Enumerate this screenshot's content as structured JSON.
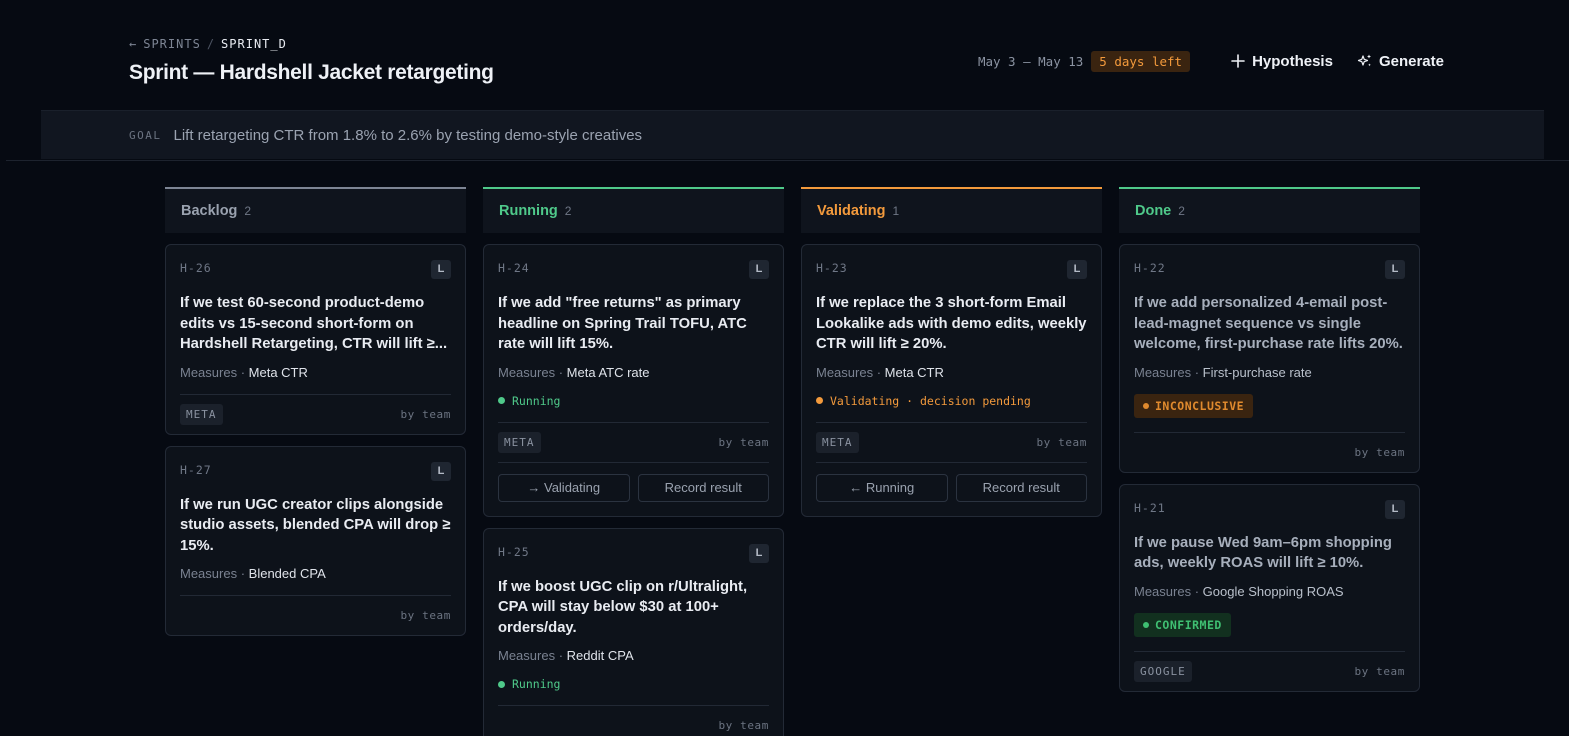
{
  "breadcrumb": {
    "back_arrow": "←",
    "parent": "SPRINTS",
    "separator": "/",
    "current": "SPRINT_D"
  },
  "page_title": "Sprint — Hardshell Jacket retargeting",
  "header": {
    "dates": "May 3 – May 13",
    "days_left": "5 days left",
    "hypothesis_button": "Hypothesis",
    "generate_button": "Generate"
  },
  "goal": {
    "label": "GOAL",
    "text": "Lift retargeting CTR from 1.8% to 2.6% by testing demo-style creatives"
  },
  "colors": {
    "backlog": "#8a92a0",
    "running": "#4fc98a",
    "validating": "#f39a3c",
    "done": "#4fc98a",
    "inconclusive_bg": "#3a2410",
    "inconclusive_fg": "#e08a2e",
    "confirmed_bg": "#12301f",
    "confirmed_fg": "#3fbf72"
  },
  "columns": [
    {
      "name": "Backlog",
      "count": "2",
      "cards": [
        {
          "id": "H-26",
          "size": "L",
          "hypothesis": "If we test 60-second product-demo edits vs 15-second short-form on Hardshell Retargeting, CTR will lift ≥...",
          "measures_label": "Measures ·",
          "metric": "Meta CTR",
          "platform": "META",
          "by": "by team"
        },
        {
          "id": "H-27",
          "size": "L",
          "hypothesis": "If we run UGC creator clips alongside studio assets, blended CPA will drop ≥ 15%.",
          "measures_label": "Measures ·",
          "metric": "Blended CPA",
          "by": "by team"
        }
      ]
    },
    {
      "name": "Running",
      "count": "2",
      "cards": [
        {
          "id": "H-24",
          "size": "L",
          "hypothesis": "If we add \"free returns\" as primary headline on Spring Trail TOFU, ATC rate will lift 15%.",
          "measures_label": "Measures ·",
          "metric": "Meta ATC rate",
          "status": "Running",
          "platform": "META",
          "by": "by team",
          "actions": [
            "→ Validating",
            "Record result"
          ]
        },
        {
          "id": "H-25",
          "size": "L",
          "hypothesis": "If we boost UGC clip on r/Ultralight, CPA will stay below $30 at 100+ orders/day.",
          "measures_label": "Measures ·",
          "metric": "Reddit CPA",
          "status": "Running",
          "by": "by team"
        }
      ]
    },
    {
      "name": "Validating",
      "count": "1",
      "cards": [
        {
          "id": "H-23",
          "size": "L",
          "hypothesis": "If we replace the 3 short-form Email Lookalike ads with demo edits, weekly CTR will lift ≥ 20%.",
          "measures_label": "Measures ·",
          "metric": "Meta CTR",
          "status": "Validating · decision pending",
          "platform": "META",
          "by": "by team",
          "actions": [
            "← Running",
            "Record result"
          ]
        }
      ]
    },
    {
      "name": "Done",
      "count": "2",
      "cards": [
        {
          "id": "H-22",
          "size": "L",
          "hypothesis": "If we add personalized 4-email post-lead-magnet sequence vs single welcome, first-purchase rate lifts 20%.",
          "measures_label": "Measures ·",
          "metric": "First-purchase rate",
          "result": "INCONCLUSIVE",
          "by": "by team"
        },
        {
          "id": "H-21",
          "size": "L",
          "hypothesis": "If we pause Wed 9am–6pm shopping ads, weekly ROAS will lift ≥ 10%.",
          "measures_label": "Measures ·",
          "metric": "Google Shopping ROAS",
          "result": "CONFIRMED",
          "platform": "GOOGLE",
          "by": "by team"
        }
      ]
    }
  ]
}
